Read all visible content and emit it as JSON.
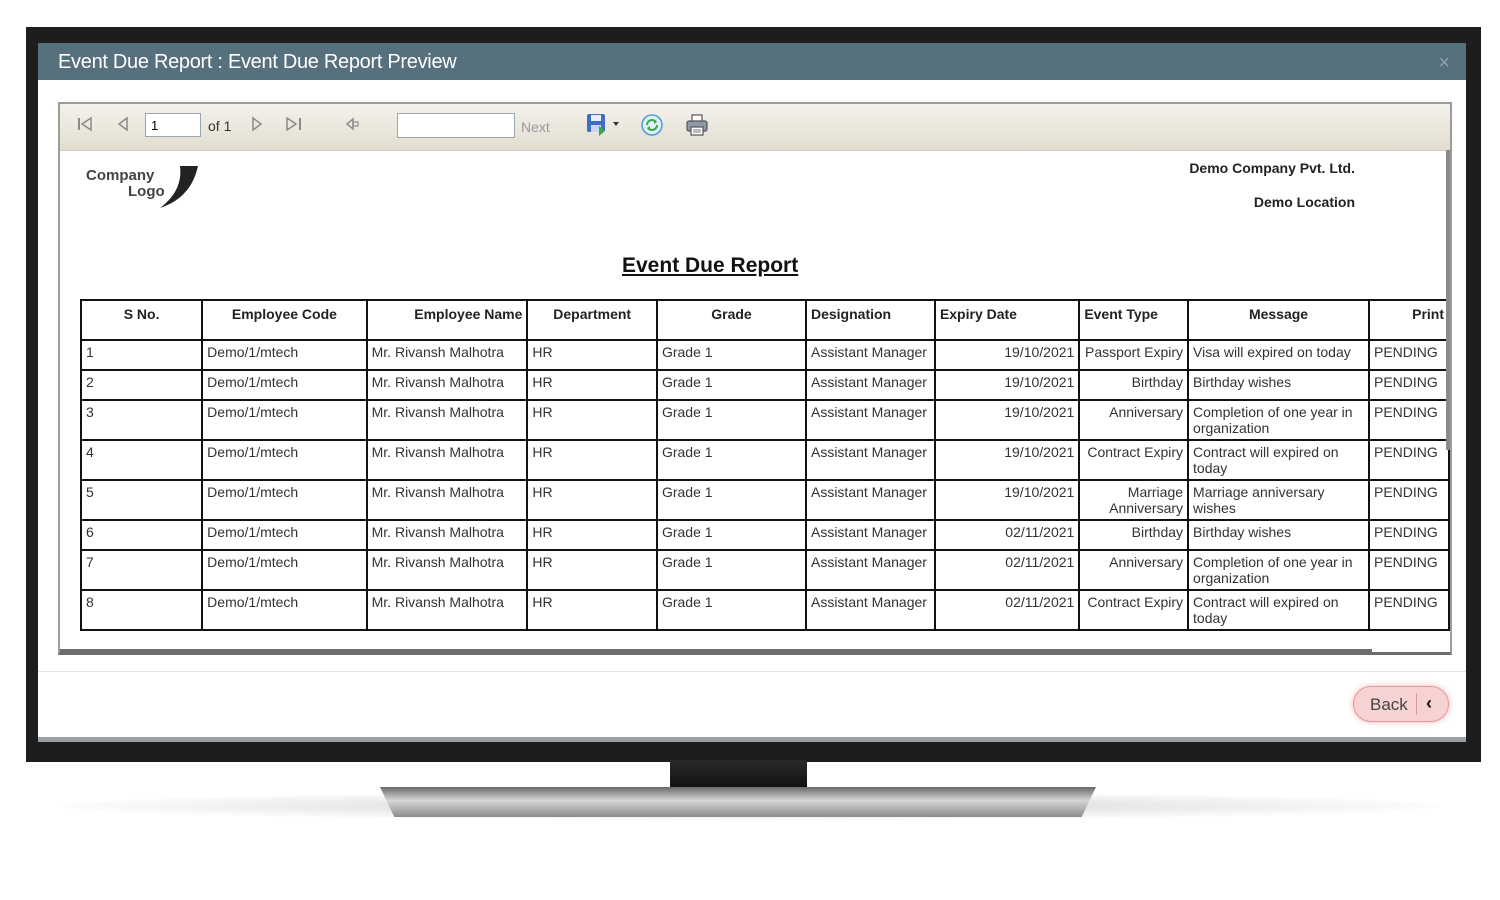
{
  "window": {
    "title": "Event Due Report : Event Due Report Preview",
    "close_glyph": "×"
  },
  "toolbar": {
    "first_glyph": "⏮",
    "prev_glyph": "◀",
    "page_value": "1",
    "of_label": "of 1",
    "next_glyph": "▷",
    "last_glyph": "▷|",
    "back_glyph": "⟲",
    "find_next_label": "Next",
    "export_glyph": "💾",
    "refresh_glyph": "⟳",
    "print_glyph": "🖨"
  },
  "report": {
    "logo_text_line1": "Company",
    "logo_text_line2": "Logo",
    "company_name": "Demo Company Pvt. Ltd.",
    "location": "Demo Location",
    "title": "Event Due Report",
    "columns": [
      "S No.",
      "Employee Code",
      "Employee Name",
      "Department",
      "Grade",
      "Designation",
      "Expiry Date",
      "Event Type",
      "Message",
      "Print"
    ],
    "rows": [
      {
        "sno": "1",
        "code": "Demo/1/mtech",
        "name": "Mr. Rivansh  Malhotra",
        "dept": "HR",
        "grade": "Grade 1",
        "designation": "Assistant Manager",
        "expiry": "19/10/2021",
        "event": "Passport Expiry",
        "message": "Visa will expired on today",
        "print": "PENDING"
      },
      {
        "sno": "2",
        "code": "Demo/1/mtech",
        "name": "Mr. Rivansh  Malhotra",
        "dept": "HR",
        "grade": "Grade 1",
        "designation": "Assistant Manager",
        "expiry": "19/10/2021",
        "event": "Birthday",
        "message": "Birthday wishes",
        "print": "PENDING"
      },
      {
        "sno": "3",
        "code": "Demo/1/mtech",
        "name": "Mr. Rivansh  Malhotra",
        "dept": "HR",
        "grade": "Grade 1",
        "designation": "Assistant Manager",
        "expiry": "19/10/2021",
        "event": "Anniversary",
        "message": "Completion of one year in organization",
        "print": "PENDING"
      },
      {
        "sno": "4",
        "code": "Demo/1/mtech",
        "name": "Mr. Rivansh  Malhotra",
        "dept": "HR",
        "grade": "Grade 1",
        "designation": "Assistant Manager",
        "expiry": "19/10/2021",
        "event": "Contract Expiry",
        "message": "Contract will expired on today",
        "print": "PENDING"
      },
      {
        "sno": "5",
        "code": "Demo/1/mtech",
        "name": "Mr. Rivansh  Malhotra",
        "dept": "HR",
        "grade": "Grade 1",
        "designation": "Assistant Manager",
        "expiry": "19/10/2021",
        "event": "Marriage Anniversary",
        "message": "Marriage anniversary wishes",
        "print": "PENDING"
      },
      {
        "sno": "6",
        "code": "Demo/1/mtech",
        "name": "Mr. Rivansh  Malhotra",
        "dept": "HR",
        "grade": "Grade 1",
        "designation": "Assistant Manager",
        "expiry": "02/11/2021",
        "event": "Birthday",
        "message": "Birthday wishes",
        "print": "PENDING"
      },
      {
        "sno": "7",
        "code": "Demo/1/mtech",
        "name": "Mr. Rivansh  Malhotra",
        "dept": "HR",
        "grade": "Grade 1",
        "designation": "Assistant Manager",
        "expiry": "02/11/2021",
        "event": "Anniversary",
        "message": "Completion of one year in organization",
        "print": "PENDING"
      },
      {
        "sno": "8",
        "code": "Demo/1/mtech",
        "name": "Mr. Rivansh  Malhotra",
        "dept": "HR",
        "grade": "Grade 1",
        "designation": "Assistant Manager",
        "expiry": "02/11/2021",
        "event": "Contract Expiry",
        "message": "Contract will expired on today",
        "print": "PENDING"
      }
    ]
  },
  "footer": {
    "back_label": "Back",
    "back_chevron": "‹"
  },
  "colors": {
    "titlebar": "#57707e",
    "toolbar": "#e9e5da",
    "back_button": "#f6d2d2"
  }
}
